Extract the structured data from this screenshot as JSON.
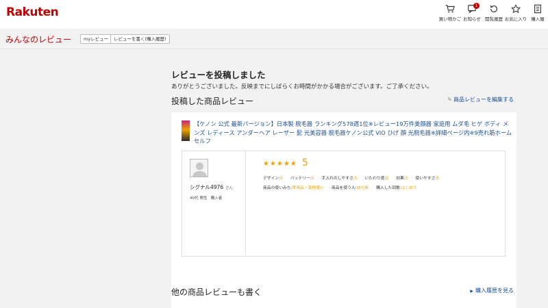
{
  "header": {
    "logo": "Rakuten",
    "nav": [
      {
        "label": "買い物かご",
        "icon": "cart-icon"
      },
      {
        "label": "お知らせ",
        "icon": "notification-icon",
        "badge": "1"
      },
      {
        "label": "閲覧履歴",
        "icon": "history-icon"
      },
      {
        "label": "お気に入り",
        "icon": "star-icon"
      },
      {
        "label": "購入履",
        "icon": "receipt-icon"
      }
    ]
  },
  "subheader": {
    "title": "みんなのレビュー",
    "my_review": "myレビュー",
    "write_review": "レビューを書く(購入履歴)"
  },
  "confirmation": {
    "title": "レビューを投稿しました",
    "message": "ありがとうございました。反映までにしばらくお時間がかかる場合がございます。ご了承ください。"
  },
  "posted": {
    "section_title": "投稿した商品レビュー",
    "edit_link": "商品レビューを編集する",
    "product_title": "【ケノン 公式 最新バージョン】日本製 脱毛器 ランキング578週1位※レビュー19万件美顔器 家庭用 ムダ毛 ヒゲ ボディ メンズ レディース アンダーヘア レーザー 髭 光美容器 脱毛器ケノン公式 VIO ひげ 顔 光脱毛器※詳細ページ内※9売れ筋ホーム セルフ",
    "review": {
      "user_name": "シグナル4976",
      "honorific": "さん",
      "user_meta": "40代 男性　購入者",
      "stars": "★★★★★",
      "score": "5",
      "criteria": [
        {
          "label": "デザイン:",
          "value": "5"
        },
        {
          "label": "バッテリー:",
          "value": "5"
        },
        {
          "label": "手入れのしやすさ:",
          "value": "5"
        },
        {
          "label": "いたわり度:",
          "value": "5"
        },
        {
          "label": "効果:",
          "value": "5"
        },
        {
          "label": "使いやすさ:",
          "value": "5"
        }
      ],
      "usage": [
        {
          "label": "商品の使いみち:",
          "value": "実用品・普段使い"
        },
        {
          "label": "商品を使う人:",
          "value": "自分用"
        },
        {
          "label": "購入した回数:",
          "value": "はじめて"
        }
      ]
    }
  },
  "other": {
    "section_title": "他の商品レビューも書く",
    "history_link": "購入履歴を見る"
  },
  "colors": {
    "brand_red": "#bf0000",
    "link_blue": "#1c4f91",
    "star_orange": "#f0a000"
  }
}
